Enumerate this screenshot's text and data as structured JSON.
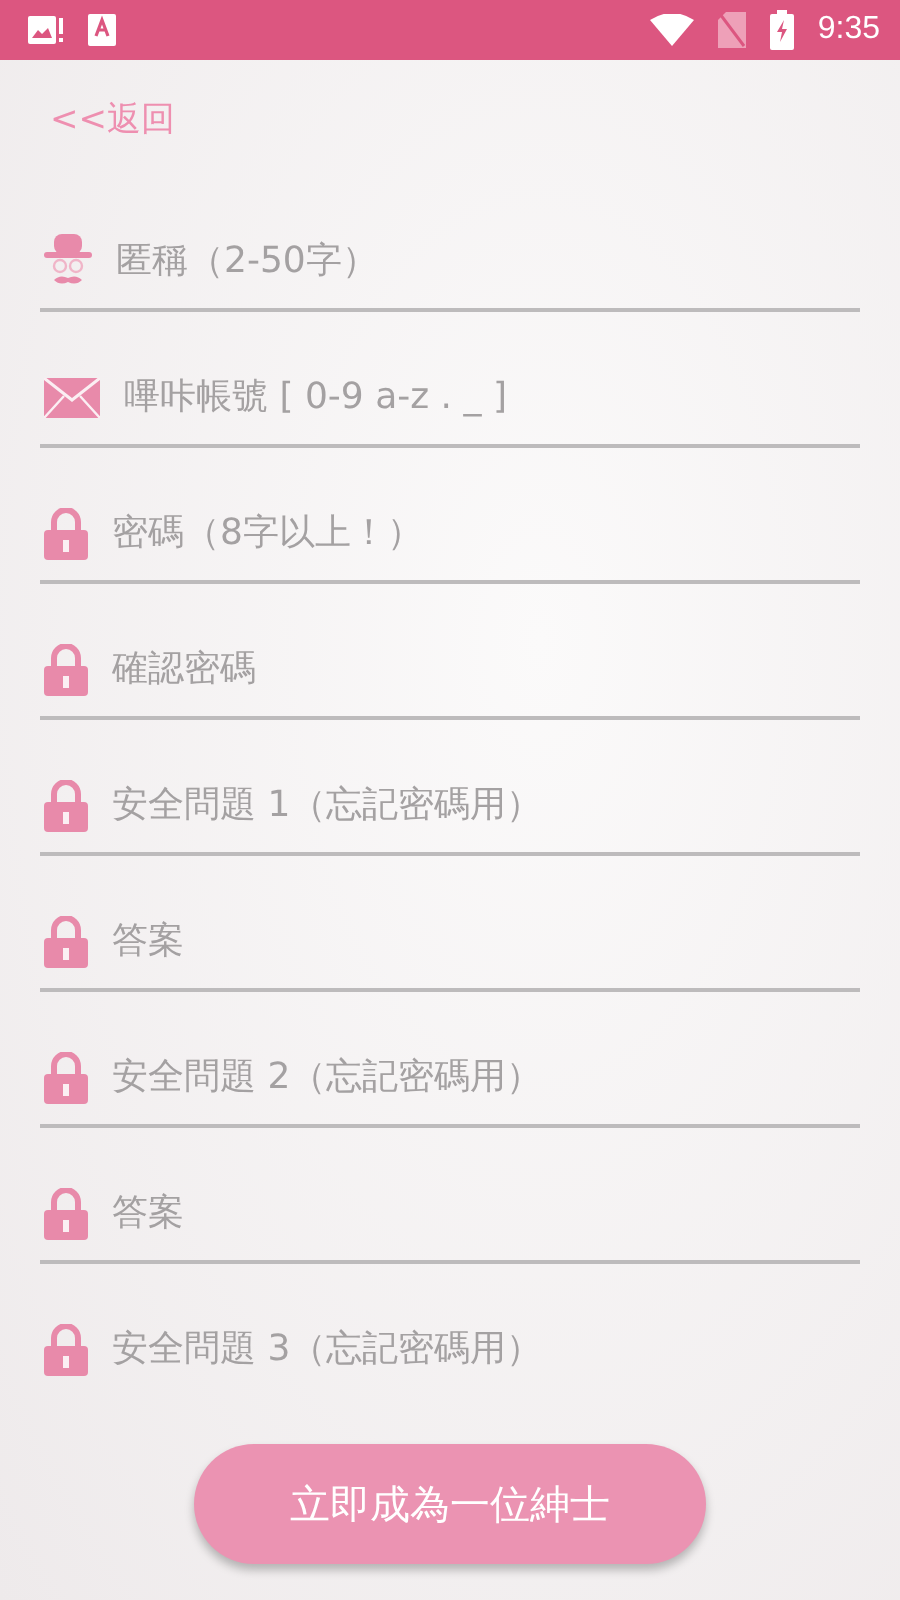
{
  "status_bar": {
    "time": "9:35"
  },
  "back_link": "<<返回",
  "fields": [
    {
      "kind": "hat",
      "placeholder": "匿稱（2-50字）",
      "underlined": true
    },
    {
      "kind": "mail",
      "placeholder": "嗶咔帳號 [ 0-9 a-z . _ ]",
      "underlined": true
    },
    {
      "kind": "lock",
      "placeholder": "密碼（8字以上！）",
      "underlined": true
    },
    {
      "kind": "lock",
      "placeholder": "確認密碼",
      "underlined": true
    },
    {
      "kind": "lock",
      "placeholder": "安全問題 1（忘記密碼用）",
      "underlined": true
    },
    {
      "kind": "lock",
      "placeholder": "答案",
      "underlined": true
    },
    {
      "kind": "lock",
      "placeholder": "安全問題 2（忘記密碼用）",
      "underlined": true
    },
    {
      "kind": "lock",
      "placeholder": "答案",
      "underlined": true
    },
    {
      "kind": "lock",
      "placeholder": "安全問題 3（忘記密碼用）",
      "underlined": false
    }
  ],
  "submit_button": "立即成為一位紳士"
}
